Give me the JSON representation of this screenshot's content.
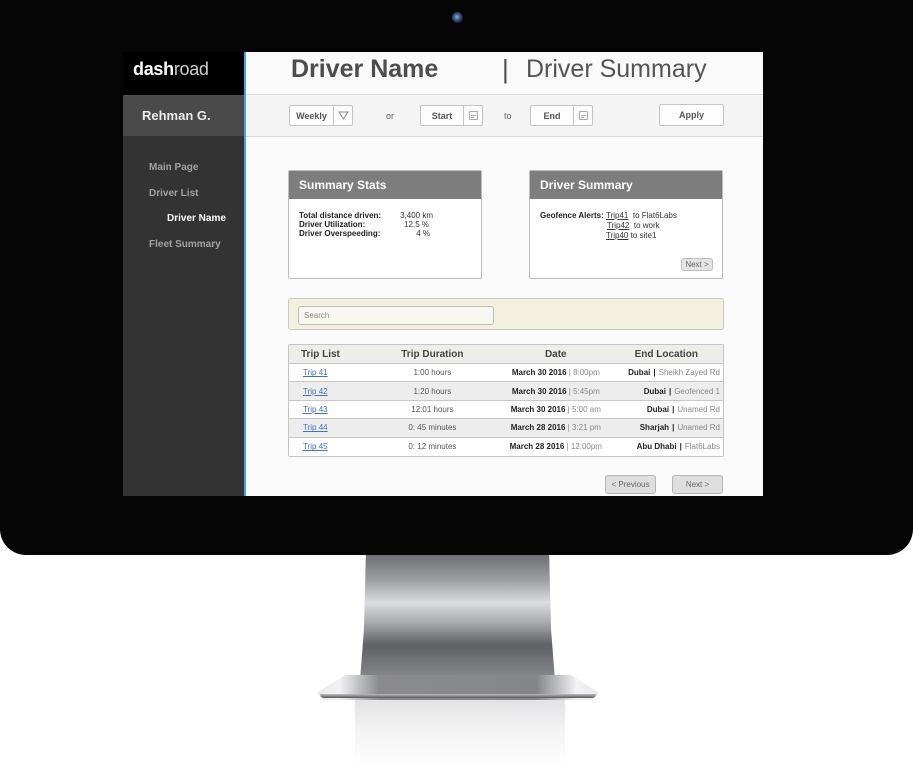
{
  "app": {
    "logo_bold": "dash",
    "logo_light": "road"
  },
  "sidebar": {
    "user_name": "Rehman G.",
    "items": [
      {
        "label": "Main Page",
        "active": false
      },
      {
        "label": "Driver List",
        "active": false
      },
      {
        "label": "Driver Name",
        "active": true
      },
      {
        "label": "Fleet Summary",
        "active": false
      }
    ]
  },
  "header": {
    "title": "Driver Name",
    "separator": "|",
    "subtitle": "Driver Summary"
  },
  "filters": {
    "period_select": "Weekly",
    "or_label": "or",
    "start_label": "Start",
    "to_label": "to",
    "end_label": "End",
    "apply_label": "Apply"
  },
  "summary_stats": {
    "title": "Summary Stats",
    "rows": [
      {
        "label": "Total distance driven:",
        "value": "3,400 km"
      },
      {
        "label": "Driver Utilization:",
        "value": "12.5 %"
      },
      {
        "label": "Driver Overspeeding:",
        "value": "4  %"
      }
    ]
  },
  "driver_summary": {
    "title": "Driver Summary",
    "alerts_label": "Geofence Alerts:",
    "alerts": [
      {
        "trip": "Trip41",
        "text": "to Flat6Labs"
      },
      {
        "trip": "Trip42",
        "text": "to work"
      },
      {
        "trip": "Trip40",
        "text": "to site1"
      }
    ],
    "next_label": "Next  >"
  },
  "search": {
    "placeholder": "Search",
    "value": ""
  },
  "trip_table": {
    "columns": [
      "Trip List",
      "Trip Duration",
      "Date",
      "End Location"
    ],
    "rows": [
      {
        "trip": "Trip 41",
        "duration": "1:00 hours",
        "date": "March 30 2016",
        "time": "8:00pm",
        "city": "Dubai",
        "place": "Sheikh Zayed Rd"
      },
      {
        "trip": "Trip 42",
        "duration": "1:20 hours",
        "date": "March 30 2016",
        "time": "5:45pm",
        "city": "Dubai",
        "place": "Geofenced 1"
      },
      {
        "trip": "Trip 43",
        "duration": "12:01 hours",
        "date": "March 30 2016",
        "time": "5:00 am",
        "city": "Dubai",
        "place": "Unamed Rd"
      },
      {
        "trip": "Trip 44",
        "duration": "0: 45 minutes",
        "date": "March 28 2016",
        "time": "3:21 pm",
        "city": "Sharjah",
        "place": "Unamed Rd"
      },
      {
        "trip": "Trip  45",
        "duration": "0: 12 minutes",
        "date": "March 28 2016",
        "time": "12:00pm",
        "city": "Abu Dhabi",
        "place": "Flat6Labs"
      }
    ]
  },
  "pagination": {
    "previous_label": "<  Previous",
    "next_label": "Next  >"
  },
  "colors": {
    "accent_divider": "#47a4e0",
    "sidebar_bg": "#333333",
    "card_header": "#7d7d7d",
    "search_panel": "#f3f0df",
    "link": "#4a6fb5"
  }
}
